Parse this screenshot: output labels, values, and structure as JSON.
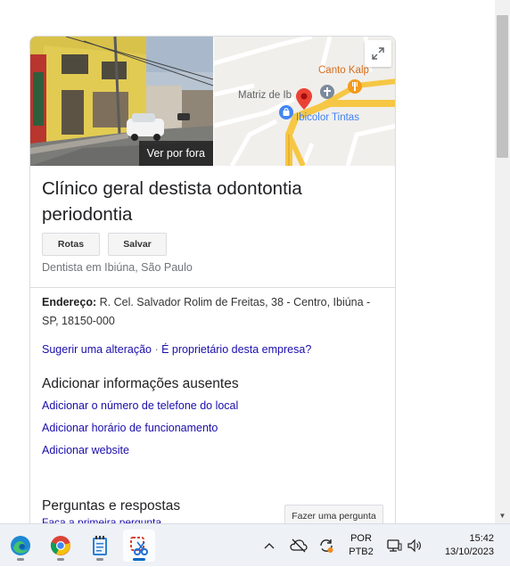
{
  "panel": {
    "photo_button": "Ver por fora",
    "map_labels": {
      "canto": "Canto Kalp",
      "matriz": "Matriz de Ib",
      "ibicolor": "Ibicolor Tintas"
    },
    "title": "Clínico geral destista odontontia periodontia",
    "actions": {
      "rotas": "Rotas",
      "salvar": "Salvar"
    },
    "category": "Dentista em Ibiúna, São Paulo",
    "address": {
      "label": "Endereço:",
      "value": "R. Cel. Salvador Rolim de Freitas, 38 - Centro, Ibiúna - SP, 18150-000"
    },
    "edit_links": {
      "suggest": "Sugerir uma alteração",
      "separator": "·",
      "owner": "É proprietário desta empresa?"
    },
    "missing": {
      "heading": "Adicionar informações ausentes",
      "links": [
        "Adicionar o número de telefone do local",
        "Adicionar horário de funcionamento",
        "Adicionar website"
      ]
    },
    "qa": {
      "heading": "Perguntas e respostas",
      "first_question": "Faça a primeira pergunta",
      "ask_button": "Fazer uma pergunta"
    }
  },
  "taskbar": {
    "apps": [
      "edge-icon",
      "chrome-icon",
      "notepad-icon",
      "snipping-tool-icon"
    ],
    "language": {
      "line1": "POR",
      "line2": "PTB2"
    },
    "clock": {
      "time": "15:42",
      "date": "13/10/2023"
    }
  },
  "colors": {
    "link": "#1a0dab",
    "map_road": "#f6c744",
    "pin": "#ea4335"
  }
}
